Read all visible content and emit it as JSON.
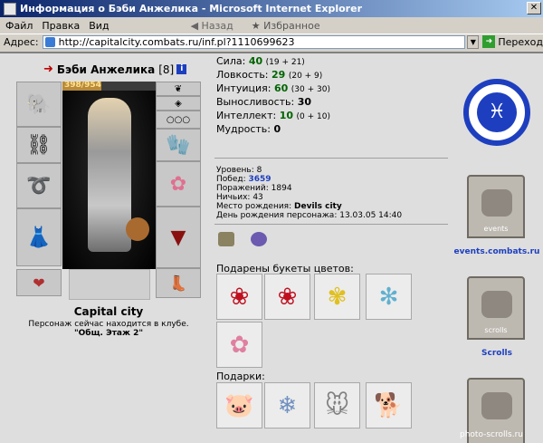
{
  "window": {
    "title": "Информация о Бэби Анжелика - Microsoft Internet Explorer"
  },
  "menu": {
    "items": [
      "Файл",
      "Правка",
      "Вид"
    ]
  },
  "toolbar": {
    "back_label": "Назад",
    "favorites_label": "Избранное"
  },
  "address": {
    "label": "Адрес:",
    "url": "http://capitalcity.combats.ru/inf.pl?1110699623",
    "go_label": "Переход"
  },
  "character": {
    "name": "Бэби Анжелика",
    "level": "[8]",
    "hp_text": "398/954",
    "hp_fraction": 0.417,
    "city": "Capital city",
    "club_text": "Персонаж сейчас находится в клубе.",
    "club_location": "\"Общ. Этаж 2\""
  },
  "stats": [
    {
      "label": "Сила:",
      "value": "40",
      "bonus": "(19 + 21)",
      "green": true
    },
    {
      "label": "Ловкость:",
      "value": "29",
      "bonus": "(20 + 9)",
      "green": true
    },
    {
      "label": "Интуиция:",
      "value": "60",
      "bonus": "(30 + 30)",
      "green": true
    },
    {
      "label": "Выносливость:",
      "value": "30",
      "bonus": "",
      "green": false
    },
    {
      "label": "Интеллект:",
      "value": "10",
      "bonus": "(0 + 10)",
      "green": true
    },
    {
      "label": "Мудрость:",
      "value": "0",
      "bonus": "",
      "green": false
    }
  ],
  "info": {
    "level_label": "Уровень:",
    "level_value": "8",
    "wins_label": "Побед:",
    "wins_value": "3659",
    "losses_label": "Поражений:",
    "losses_value": "1894",
    "draws_label": "Ничьих:",
    "draws_value": "43",
    "birthplace_label": "Место рождения:",
    "birthplace_value": "Devils city",
    "birthday_label": "День рождения персонажа:",
    "birthday_value": "13.03.05 14:40"
  },
  "sections": {
    "bouquets_label": "Подарены букеты цветов:",
    "gifts_label": "Подарки:"
  },
  "right": {
    "events_label": "events.combats.ru",
    "scrolls_label": "Scrolls",
    "banner1_text": "events",
    "banner2_text": "scrolls"
  },
  "watermark": "photo-scrolls.ru"
}
